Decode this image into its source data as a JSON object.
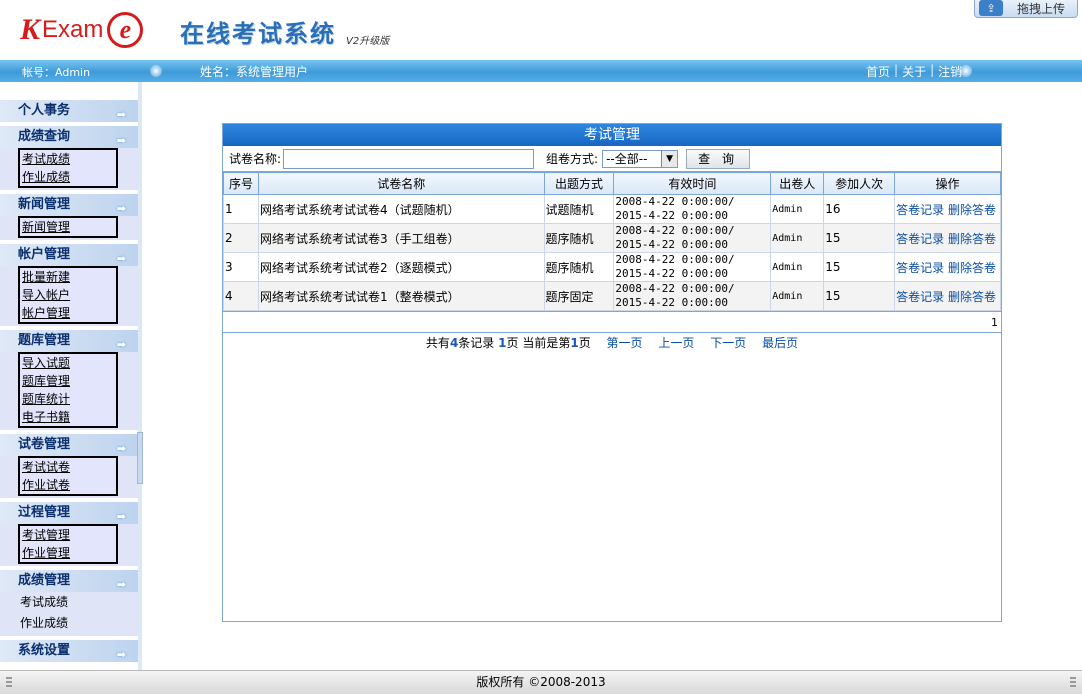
{
  "header": {
    "logo_k": "K",
    "logo_exam": "Exam",
    "logo_e": "e",
    "title": "在线考试系统",
    "version": "V2升级版",
    "upload_label": "拖拽上传"
  },
  "navbar": {
    "account": "帐号：Admin",
    "name": "姓名：系统管理用户",
    "links": [
      "首页",
      "关于",
      "注销"
    ],
    "separator": "|"
  },
  "sidebar": {
    "sections": [
      {
        "title": "个人事务",
        "items": []
      },
      {
        "title": "成绩查询",
        "items": [
          "考试成绩",
          "作业成绩"
        ]
      },
      {
        "title": "新闻管理",
        "items": [
          "新闻管理"
        ]
      },
      {
        "title": "帐户管理",
        "items": [
          "批量新建",
          "导入帐户",
          "帐户管理"
        ]
      },
      {
        "title": "题库管理",
        "items": [
          "导入试题",
          "题库管理",
          "题库统计",
          "电子书籍"
        ]
      },
      {
        "title": "试卷管理",
        "items": [
          "考试试卷",
          "作业试卷"
        ]
      },
      {
        "title": "过程管理",
        "items": [
          "考试管理",
          "作业管理"
        ]
      },
      {
        "title": "成绩管理",
        "items": [
          "考试成绩",
          "作业成绩"
        ]
      },
      {
        "title": "系统设置",
        "items": []
      }
    ]
  },
  "main": {
    "panel_title": "考试管理",
    "search": {
      "label": "试卷名称:",
      "value": "",
      "placeholder": "",
      "mode_label": "组卷方式:",
      "mode_selected": "--全部--",
      "query_label": "查 询"
    },
    "table": {
      "headers": [
        "序号",
        "试卷名称",
        "出题方式",
        "有效时间",
        "出卷人",
        "参加人次",
        "操作"
      ],
      "rows": [
        {
          "no": "1",
          "name": "网络考试系统考试试卷4（试题随机）",
          "mode": "试题随机",
          "time1": "2008-4-22 0:00:00/",
          "time2": "2015-4-22 0:00:00",
          "author": "Admin",
          "count": "16"
        },
        {
          "no": "2",
          "name": "网络考试系统考试试卷3（手工组卷）",
          "mode": "题序随机",
          "time1": "2008-4-22 0:00:00/",
          "time2": "2015-4-22 0:00:00",
          "author": "Admin",
          "count": "15"
        },
        {
          "no": "3",
          "name": "网络考试系统考试试卷2（逐题模式）",
          "mode": "题序随机",
          "time1": "2008-4-22 0:00:00/",
          "time2": "2015-4-22 0:00:00",
          "author": "Admin",
          "count": "15"
        },
        {
          "no": "4",
          "name": "网络考试系统考试试卷1（整卷模式）",
          "mode": "题序固定",
          "time1": "2008-4-22 0:00:00/",
          "time2": "2015-4-22 0:00:00",
          "author": "Admin",
          "count": "15"
        }
      ],
      "op_records": "答卷记录",
      "op_delete": "删除答卷",
      "page_index": "1"
    },
    "pager": {
      "prefix": "共有",
      "total": "4",
      "records_suffix": "条记录",
      "pages": "1",
      "pages_suffix": "页 当前是第",
      "current": "1",
      "current_suffix": "页",
      "first": "第一页",
      "prev": "上一页",
      "next": "下一页",
      "last": "最后页"
    }
  },
  "footer": {
    "copyright": "版权所有 ©2008-2013"
  }
}
